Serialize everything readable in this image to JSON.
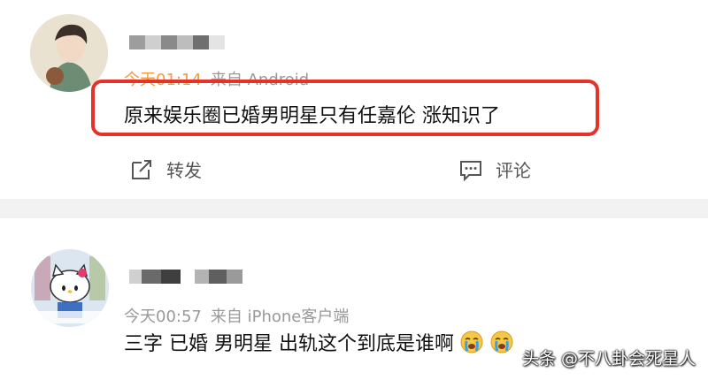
{
  "comments": [
    {
      "meta_time": "今天01:14",
      "meta_source": "来自 Android",
      "text": "原来娱乐圈已婚男明星只有任嘉伦 涨知识了",
      "actions": {
        "repost": "转发",
        "comment": "评论"
      },
      "avatar_icon": "anime-man-avatar",
      "colors": {
        "time": "#f59a3c",
        "highlight_border": "#e5332a"
      }
    },
    {
      "meta_time": "今天00:57",
      "meta_source": "来自 iPhone客户端",
      "text": "三字 已婚 男明星 出轨这个到底是谁啊",
      "emojis": [
        "crying-face-icon",
        "crying-face-icon"
      ],
      "avatar_icon": "hello-kitty-avatar"
    }
  ],
  "watermark": "头条 @不八卦会死星人"
}
